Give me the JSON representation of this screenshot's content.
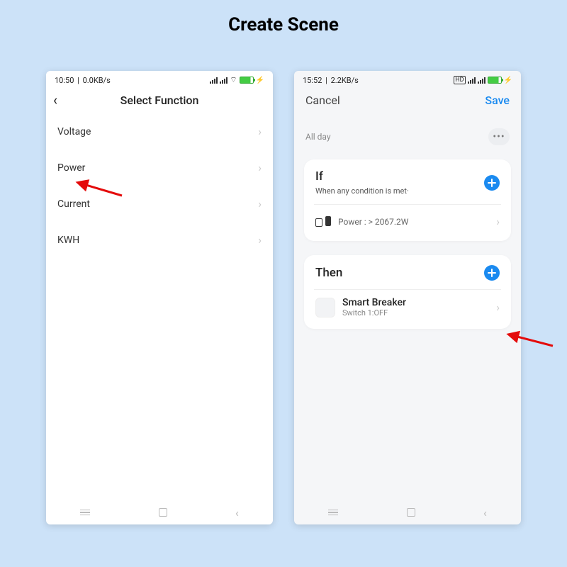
{
  "page": {
    "title": "Create Scene"
  },
  "phone1": {
    "status": {
      "time": "10:50",
      "speed": "0.0KB/s"
    },
    "nav": {
      "title": "Select Function"
    },
    "items": [
      {
        "label": "Voltage"
      },
      {
        "label": "Power"
      },
      {
        "label": "Current"
      },
      {
        "label": "KWH"
      }
    ]
  },
  "phone2": {
    "status": {
      "time": "15:52",
      "speed": "2.2KB/s"
    },
    "nav": {
      "cancel": "Cancel",
      "save": "Save"
    },
    "schedule": {
      "label": "All day"
    },
    "if_card": {
      "title": "If",
      "subtitle": "When any condition is met·",
      "condition": "Power : > 2067.2W"
    },
    "then_card": {
      "title": "Then",
      "device_name": "Smart Breaker",
      "device_action": "Switch 1:OFF"
    }
  }
}
